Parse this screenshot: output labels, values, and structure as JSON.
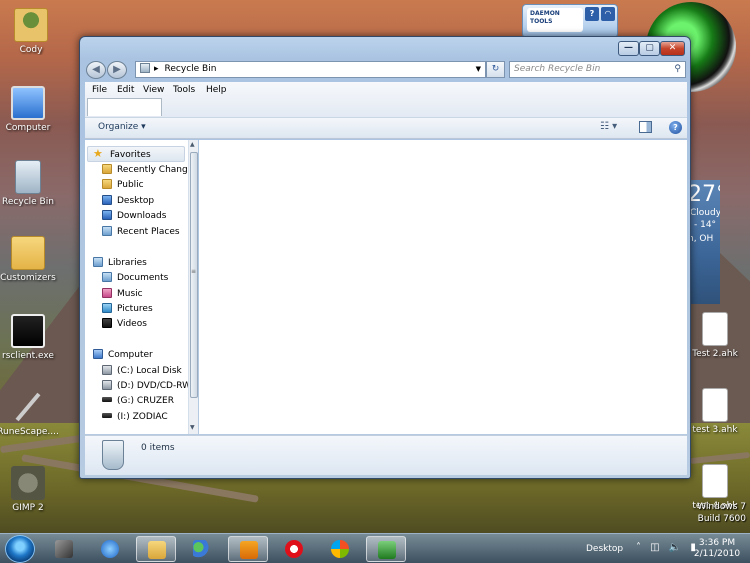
{
  "desktop": {
    "icons": [
      {
        "label": "Cody"
      },
      {
        "label": "Computer"
      },
      {
        "label": "Recycle Bin"
      },
      {
        "label": "Customizers"
      },
      {
        "label": "rsclient.exe"
      },
      {
        "label": "RuneScape...."
      },
      {
        "label": "GIMP 2"
      },
      {
        "label": "Test 2.ahk"
      },
      {
        "label": "test 3.ahk"
      },
      {
        "label": "test 4.ahk"
      }
    ],
    "daemon_tools": {
      "logo": "DAEMON TOOLS",
      "help_label": "?"
    },
    "weather": {
      "temp": "27°",
      "condition": "Cloudy",
      "range": "- 14°",
      "location": "h, OH"
    },
    "watermark": {
      "line1": "Windows 7",
      "line2": "Build 7600"
    }
  },
  "window": {
    "title_buttons": {
      "minimize": "—",
      "maximize": "▢",
      "close": "✕"
    },
    "address": {
      "location": "Recycle Bin"
    },
    "search": {
      "placeholder": "Search Recycle Bin"
    },
    "menu": [
      "File",
      "Edit",
      "View",
      "Tools",
      "Help"
    ],
    "commandbar": {
      "organize": "Organize ▾"
    },
    "nav": {
      "favorites": {
        "label": "Favorites",
        "items": [
          "Recently Changed",
          "Public",
          "Desktop",
          "Downloads",
          "Recent Places"
        ]
      },
      "libraries": {
        "label": "Libraries",
        "items": [
          "Documents",
          "Music",
          "Pictures",
          "Videos"
        ]
      },
      "computer": {
        "label": "Computer",
        "items": [
          "(C:) Local Disk",
          "(D:) DVD/CD-RW",
          "(G:) CRUZER",
          "(I:) ZODIAC"
        ]
      }
    },
    "details": {
      "count": "0 items"
    }
  },
  "taskbar": {
    "desktop_label": "Desktop",
    "clock": {
      "time": "3:36 PM",
      "date": "2/11/2010"
    }
  },
  "colors": {
    "window_frame": "#a9c3e1",
    "close_button": "#c6452b",
    "taskbar": "#3c5064"
  }
}
